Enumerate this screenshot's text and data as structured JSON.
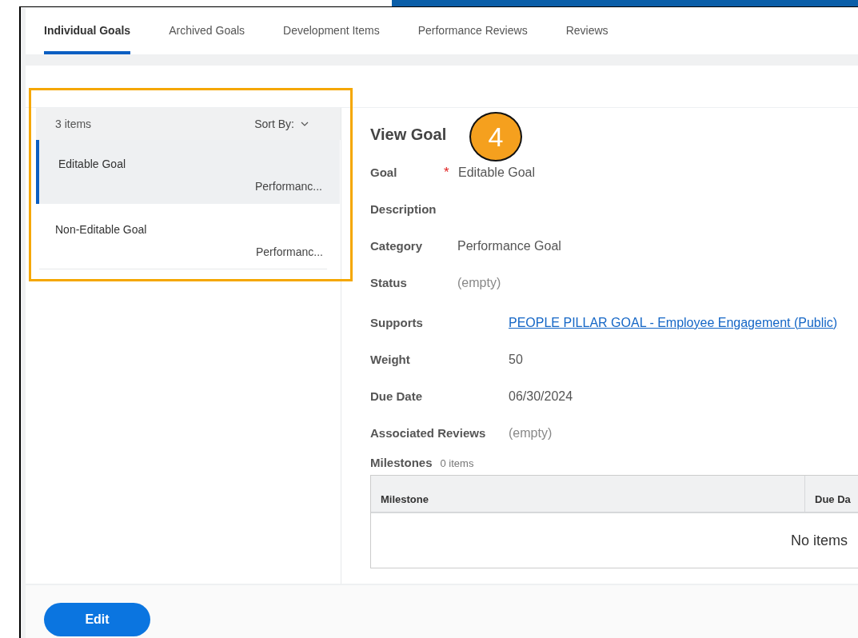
{
  "tabs": [
    {
      "label": "Individual Goals",
      "selected": true
    },
    {
      "label": "Archived Goals",
      "selected": false
    },
    {
      "label": "Development Items",
      "selected": false
    },
    {
      "label": "Performance Reviews",
      "selected": false
    },
    {
      "label": "Reviews",
      "selected": false
    }
  ],
  "list": {
    "count": "3 items",
    "sort_label": "Sort By:",
    "items": [
      {
        "title": "Editable Goal",
        "subtitle": "Performanc...",
        "selected": true
      },
      {
        "title": "Non-Editable Goal",
        "subtitle": "Performanc...",
        "selected": false
      }
    ]
  },
  "callout": {
    "number": "4"
  },
  "detail": {
    "title": "View Goal",
    "fields": [
      {
        "label": "Goal",
        "marker": "*",
        "value": "Editable Goal",
        "kind": "text"
      },
      {
        "label": "Description"
      },
      {
        "label": "Category",
        "value": "Performance Goal",
        "kind": "text"
      },
      {
        "label": "Status",
        "value": "(empty)",
        "kind": "empty"
      }
    ],
    "more_fields": [
      {
        "label": "Supports",
        "value": "PEOPLE PILLAR GOAL - Employee Engagement (Public)",
        "kind": "link"
      },
      {
        "label": "Weight",
        "value": "50",
        "kind": "text"
      },
      {
        "label": "Due Date",
        "value": "06/30/2024",
        "kind": "text"
      },
      {
        "label": "Associated Reviews",
        "value": "(empty)",
        "kind": "empty"
      }
    ],
    "milestones": {
      "label": "Milestones",
      "count": "0 items",
      "columns": [
        "Milestone",
        "Due Da"
      ],
      "empty_message": "No items"
    }
  },
  "buttons": [
    {
      "label": "Edit"
    }
  ]
}
